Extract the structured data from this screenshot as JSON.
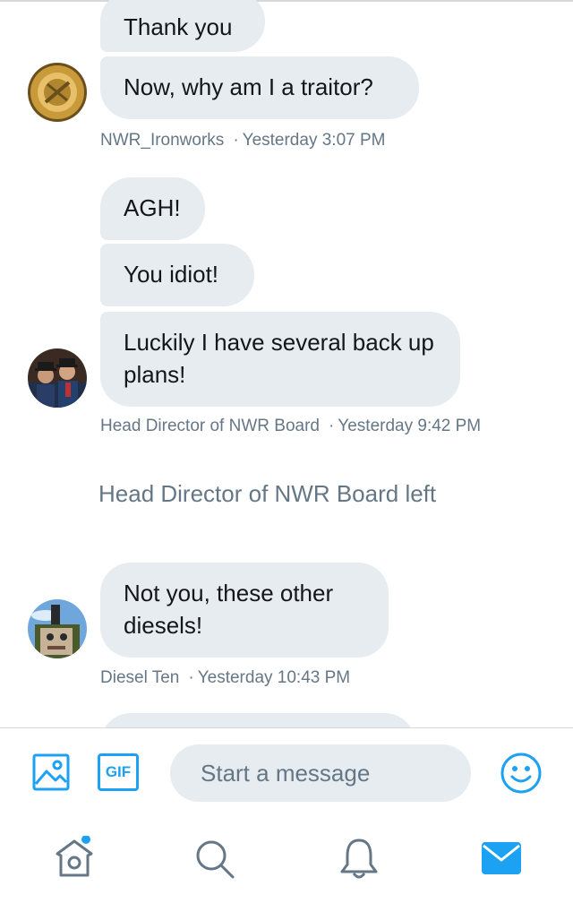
{
  "conversation": {
    "group1": {
      "messages": [
        "Thank you",
        "Now, why am I a traitor?"
      ],
      "sender": "NWR_Ironworks",
      "time": "Yesterday 3:07 PM"
    },
    "group2": {
      "messages": [
        "AGH!",
        "You idiot!",
        "Luckily I have several back up plans!"
      ],
      "sender": "Head Director of NWR Board",
      "time": "Yesterday 9:42 PM"
    },
    "system_event": "Head Director of NWR Board left",
    "group3": {
      "messages": [
        "Not you, these other diesels!"
      ],
      "sender": "Diesel Ten",
      "time": "Yesterday 10:43 PM"
    }
  },
  "composer": {
    "placeholder": "Start a message",
    "gif_label": "GIF"
  },
  "colors": {
    "accent": "#1da1f2",
    "bubble": "#e6ecf0",
    "meta_text": "#657786"
  },
  "icons": {
    "composer": [
      "image-icon",
      "gif-icon",
      "emoji-icon"
    ],
    "tabbar": [
      "home-icon",
      "search-icon",
      "notifications-icon",
      "messages-icon"
    ]
  }
}
